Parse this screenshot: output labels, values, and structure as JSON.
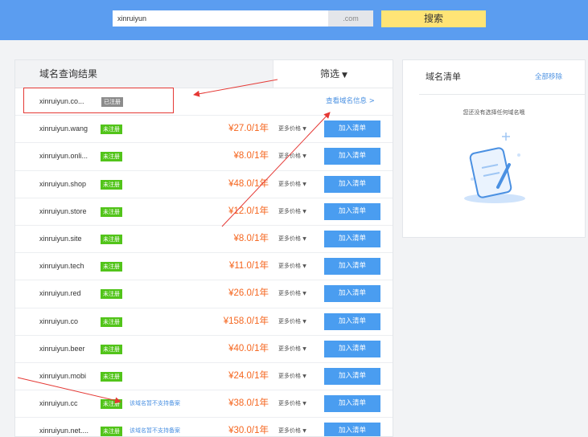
{
  "search": {
    "value": "xinruiyun",
    "suffix": ".com",
    "button": "搜索"
  },
  "results": {
    "title": "域名查询结果",
    "filter": "筛选",
    "rows": [
      {
        "domain": "xinruiyun.co...",
        "status": "已注册",
        "registered": true,
        "link": "查看域名信息 >"
      },
      {
        "domain": "xinruiyun.wang",
        "status": "未注册",
        "price": "¥27.0/1年",
        "more": "更多价格",
        "add": "加入清单"
      },
      {
        "domain": "xinruiyun.onli...",
        "status": "未注册",
        "price": "¥8.0/1年",
        "more": "更多价格",
        "add": "加入清单"
      },
      {
        "domain": "xinruiyun.shop",
        "status": "未注册",
        "price": "¥48.0/1年",
        "more": "更多价格",
        "add": "加入清单"
      },
      {
        "domain": "xinruiyun.store",
        "status": "未注册",
        "price": "¥12.0/1年",
        "more": "更多价格",
        "add": "加入清单"
      },
      {
        "domain": "xinruiyun.site",
        "status": "未注册",
        "price": "¥8.0/1年",
        "more": "更多价格",
        "add": "加入清单"
      },
      {
        "domain": "xinruiyun.tech",
        "status": "未注册",
        "price": "¥11.0/1年",
        "more": "更多价格",
        "add": "加入清单"
      },
      {
        "domain": "xinruiyun.red",
        "status": "未注册",
        "price": "¥26.0/1年",
        "more": "更多价格",
        "add": "加入清单"
      },
      {
        "domain": "xinruiyun.co",
        "status": "未注册",
        "price": "¥158.0/1年",
        "more": "更多价格",
        "add": "加入清单"
      },
      {
        "domain": "xinruiyun.beer",
        "status": "未注册",
        "price": "¥40.0/1年",
        "more": "更多价格",
        "add": "加入清单"
      },
      {
        "domain": "xinruiyun.mobi",
        "status": "未注册",
        "price": "¥24.0/1年",
        "more": "更多价格",
        "add": "加入清单"
      },
      {
        "domain": "xinruiyun.cc",
        "status": "未注册",
        "note": "该域名暂不支持备案",
        "price": "¥38.0/1年",
        "more": "更多价格",
        "add": "加入清单"
      },
      {
        "domain": "xinruiyun.net....",
        "status": "未注册",
        "note": "该域名暂不支持备案",
        "price": "¥30.0/1年",
        "more": "更多价格",
        "add": "加入清单"
      }
    ]
  },
  "cart": {
    "title": "域名清单",
    "remove_all": "全部移除",
    "empty_text": "您还没有选择任何域名哦"
  },
  "colors": {
    "topbar": "#5b9df0",
    "search_button": "#ffe476",
    "price": "#f5661f",
    "add_button": "#4a9df0",
    "badge_unregistered": "#52c41a",
    "badge_registered": "#8c8c8c",
    "annotation": "#e53935"
  },
  "icons": {
    "filter_caret": "caret-down-icon",
    "cart_illustration": "empty-list-illustration"
  }
}
